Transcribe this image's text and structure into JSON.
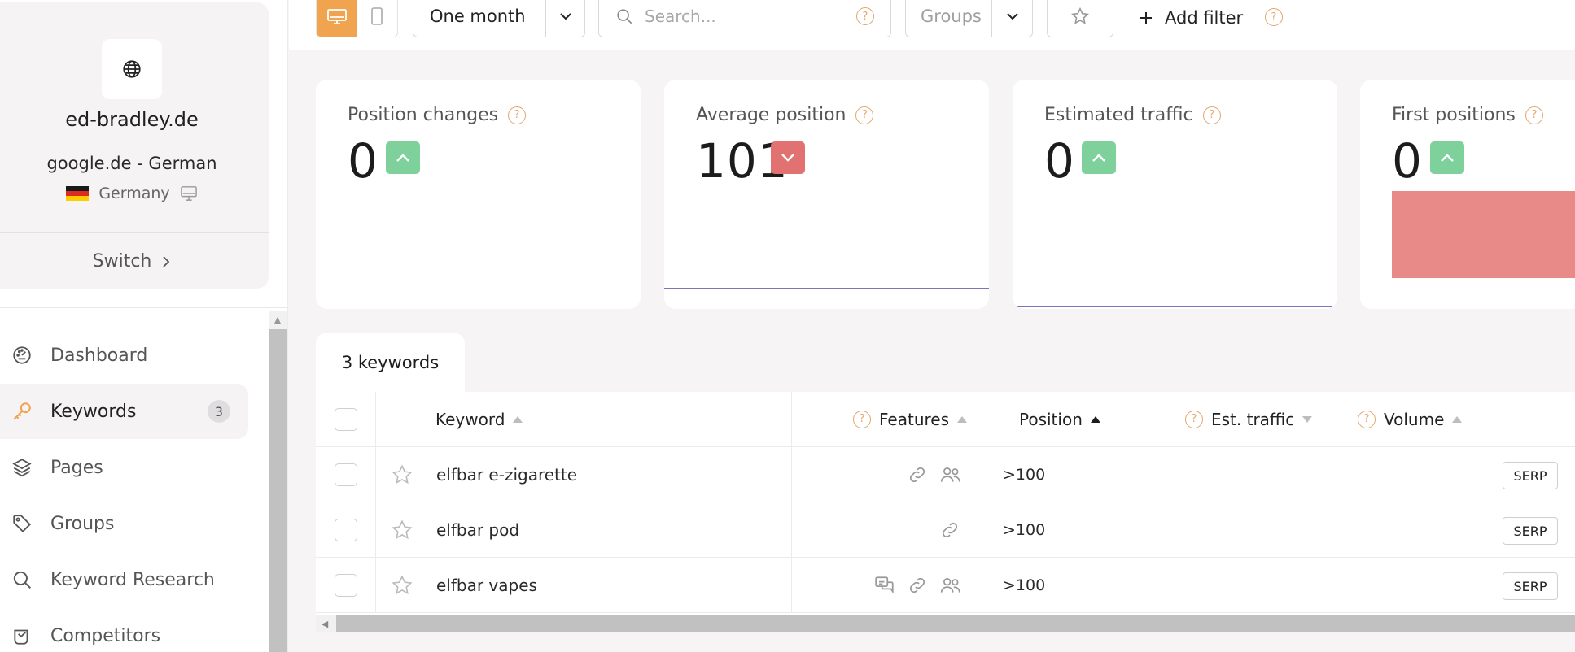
{
  "site": {
    "name": "ed-bradley.de",
    "engine": "google.de - German",
    "country": "Germany",
    "switch_label": "Switch"
  },
  "nav": {
    "items": [
      {
        "label": "Dashboard",
        "icon": "dashboard-gauge-icon"
      },
      {
        "label": "Keywords",
        "icon": "key-icon",
        "badge": "3",
        "active": true
      },
      {
        "label": "Pages",
        "icon": "layers-icon"
      },
      {
        "label": "Groups",
        "icon": "tag-icon"
      },
      {
        "label": "Keyword Research",
        "icon": "search-icon"
      },
      {
        "label": "Competitors",
        "icon": "competitors-icon"
      }
    ]
  },
  "toolbar": {
    "period": "One month",
    "search_placeholder": "Search...",
    "groups_placeholder": "Groups",
    "add_filter": "Add filter",
    "help_glyph": "?"
  },
  "cards": [
    {
      "title": "Position changes",
      "value": "0",
      "trend": "up"
    },
    {
      "title": "Average position",
      "value": "101",
      "trend": "down"
    },
    {
      "title": "Estimated traffic",
      "value": "0",
      "trend": "up"
    },
    {
      "title": "First positions",
      "value": "0",
      "trend": "up"
    }
  ],
  "table": {
    "tab_label": "3 keywords",
    "columns": {
      "keyword": "Keyword",
      "features": "Features",
      "position": "Position",
      "est_traffic": "Est. traffic",
      "volume": "Volume"
    },
    "rows": [
      {
        "keyword": "elfbar e-zigarette",
        "features": [
          "link-icon",
          "people-icon"
        ],
        "position": ">100",
        "serp": "SERP"
      },
      {
        "keyword": "elfbar pod",
        "features": [
          "link-icon"
        ],
        "position": ">100",
        "serp": "SERP"
      },
      {
        "keyword": "elfbar vapes",
        "features": [
          "reviews-icon",
          "link-icon",
          "people-icon"
        ],
        "position": ">100",
        "serp": "SERP"
      }
    ]
  },
  "colors": {
    "accent": "#f0a450",
    "up": "#7fd19b",
    "down": "#e27272",
    "first_positions_bar": "#e88a87",
    "line": "#7b76b8"
  }
}
